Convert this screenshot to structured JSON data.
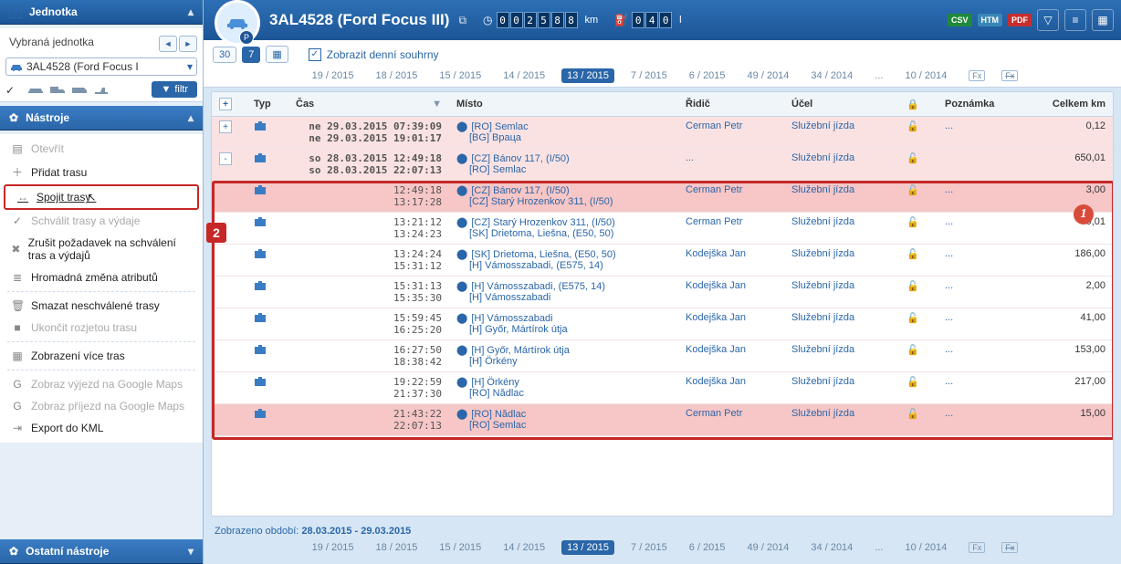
{
  "sidebar": {
    "unit_panel_title": "Jednotka",
    "selected_label": "Vybraná jednotka",
    "unit_name": "3AL4528 (Ford Focus I",
    "filter_btn": "filtr",
    "tools_title": "Nástroje",
    "other_tools_title": "Ostatní nástroje",
    "tools": [
      {
        "label": "Otevřít",
        "state": "disabled"
      },
      {
        "label": "Přidat trasu",
        "state": "active"
      },
      {
        "label": "Spojit trasy",
        "state": "active",
        "highlight": true
      },
      {
        "label": "Schválit trasy a výdaje",
        "state": "disabled"
      },
      {
        "label": "Zrušit požadavek na schválení tras a výdajů",
        "state": "active"
      },
      {
        "label": "Hromadná změna atributů",
        "state": "active"
      },
      {
        "label": "Smazat neschválené trasy",
        "state": "active"
      },
      {
        "label": "Ukončit rozjetou trasu",
        "state": "disabled"
      },
      {
        "label": "Zobrazení více tras",
        "state": "active"
      },
      {
        "label": "Zobraz výjezd na Google Maps",
        "state": "disabled"
      },
      {
        "label": "Zobraz příjezd na Google Maps",
        "state": "disabled"
      },
      {
        "label": "Export do KML",
        "state": "active"
      }
    ]
  },
  "header": {
    "title": "3AL4528 (Ford Focus III)",
    "odometer_digits": [
      "0",
      "0",
      "2",
      "5",
      "8",
      "8"
    ],
    "odometer_unit": "km",
    "fuel_digits": [
      "0",
      "4",
      "0"
    ],
    "fuel_unit": "l",
    "export": {
      "csv": "CSV",
      "htm": "HTM",
      "pdf": "PDF"
    }
  },
  "periodbar": {
    "range30": "30",
    "range7": "7",
    "daily_summary_label": "Zobrazit denní souhrny",
    "periods": [
      "19 / 2015",
      "18 / 2015",
      "15 / 2015",
      "14 / 2015",
      "13 / 2015",
      "7 / 2015",
      "6 / 2015",
      "49 / 2014",
      "34 / 2014",
      "...",
      "10 / 2014"
    ],
    "selected": "13 / 2015"
  },
  "table": {
    "headers": {
      "typ": "Typ",
      "cas": "Čas",
      "misto": "Místo",
      "ridic": "Řidič",
      "ucel": "Účel",
      "pozn": "Poznámka",
      "km": "Celkem km"
    },
    "rows": [
      {
        "kind": "summary",
        "exp": "+",
        "t1": "ne 29.03.2015 07:39:09",
        "t2": "ne 29.03.2015 19:01:17",
        "p1": "[RO] Semlac",
        "p2": "[BG] Враца",
        "driver": "Cerman Petr",
        "purpose": "Služební jízda",
        "note": "...",
        "km": "0,12"
      },
      {
        "kind": "summary",
        "exp": "-",
        "t1": "so 28.03.2015 12:49:18",
        "t2": "so 28.03.2015 22:07:13",
        "p1": "[CZ] Bánov 117, (I/50)",
        "p2": "[RO] Semlac",
        "driver": "...",
        "purpose": "Služební jízda",
        "note": "",
        "km": "650,01"
      },
      {
        "kind": "child",
        "sel": true,
        "dark": true,
        "t1": "12:49:18",
        "t2": "13:17:28",
        "p1": "[CZ] Bánov 117, (I/50)",
        "p2": "[CZ] Starý Hrozenkov 311, (I/50)",
        "driver": "Cerman Petr",
        "purpose": "Služební jízda",
        "note": "...",
        "km": "3,00"
      },
      {
        "kind": "child",
        "t1": "13:21:12",
        "t2": "13:24:23",
        "p1": "[CZ] Starý Hrozenkov 311, (I/50)",
        "p2": "[SK] Drietoma, Liešna, (E50, 50)",
        "driver": "Cerman Petr",
        "purpose": "Služební jízda",
        "note": "...",
        "km": "0,01"
      },
      {
        "kind": "child",
        "t1": "13:24:24",
        "t2": "15:31:12",
        "p1": "[SK] Drietoma, Liešna, (E50, 50)",
        "p2": "[H] Vámosszabadi, (E575, 14)",
        "driver": "Kodejška Jan",
        "purpose": "Služební jízda",
        "note": "...",
        "km": "186,00"
      },
      {
        "kind": "child",
        "t1": "15:31:13",
        "t2": "15:35:30",
        "p1": "[H] Vámosszabadi, (E575, 14)",
        "p2": "[H] Vámosszabadi",
        "driver": "Kodejška Jan",
        "purpose": "Služební jízda",
        "note": "...",
        "km": "2,00"
      },
      {
        "kind": "child",
        "t1": "15:59:45",
        "t2": "16:25:20",
        "p1": "[H] Vámosszabadi",
        "p2": "[H] Győr, Mártírok útja",
        "driver": "Kodejška Jan",
        "purpose": "Služební jízda",
        "note": "...",
        "km": "41,00"
      },
      {
        "kind": "child",
        "t1": "16:27:50",
        "t2": "18:38:42",
        "p1": "[H] Győr, Mártírok útja",
        "p2": "[H] Örkény",
        "driver": "Kodejška Jan",
        "purpose": "Služební jízda",
        "note": "...",
        "km": "153,00"
      },
      {
        "kind": "child",
        "t1": "19:22:59",
        "t2": "21:37:30",
        "p1": "[H] Örkény",
        "p2": "[RO] Nădlac",
        "driver": "Kodejška Jan",
        "purpose": "Služební jízda",
        "note": "...",
        "km": "217,00"
      },
      {
        "kind": "child",
        "sel": true,
        "dark": true,
        "t1": "21:43:22",
        "t2": "22:07:13",
        "p1": "[RO] Nădlac",
        "p2": "[RO] Semlac",
        "driver": "Cerman Petr",
        "purpose": "Služební jízda",
        "note": "...",
        "km": "15,00"
      }
    ]
  },
  "footer": {
    "shown_label": "Zobrazeno období:",
    "range": "28.03.2015 - 29.03.2015"
  },
  "callouts": {
    "one": "1",
    "two": "2"
  }
}
